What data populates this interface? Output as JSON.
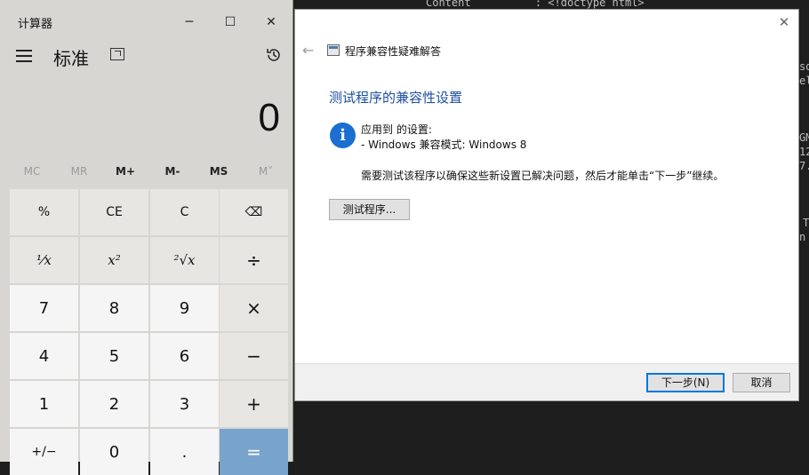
{
  "terminal": {
    "lines": [
      "Content          : <!doctype html>",
      "sd",
      "el",
      "GM",
      "12",
      "7.",
      "T",
      "n"
    ]
  },
  "calculator": {
    "title": "计算器",
    "window_buttons": {
      "minimize": "─",
      "maximize": "☐",
      "close": "✕"
    },
    "mode": "标准",
    "display": "0",
    "memory": [
      "MC",
      "MR",
      "M+",
      "M-",
      "MS",
      "M˅"
    ],
    "keys": [
      [
        "%",
        "CE",
        "C",
        "⌫"
      ],
      [
        "¹⁄x",
        "x²",
        "²√x",
        "÷"
      ],
      [
        "7",
        "8",
        "9",
        "×"
      ],
      [
        "4",
        "5",
        "6",
        "−"
      ],
      [
        "1",
        "2",
        "3",
        "+"
      ],
      [
        "+/−",
        "0",
        ".",
        "="
      ]
    ],
    "colors": {
      "background": "#d7d6d2",
      "equals": "#78a4cc"
    }
  },
  "dialog": {
    "close": "✕",
    "back": "←",
    "app_title": "程序兼容性疑难解答",
    "heading": "测试程序的兼容性设置",
    "applied_label": "应用到  的设置:",
    "applied_value": "- Windows 兼容模式: Windows 8",
    "instructions": "需要测试该程序以确保这些新设置已解决问题，然后才能单击“下一步”继续。",
    "test_button": "测试程序...",
    "next_button": "下一步(N)",
    "cancel_button": "取消",
    "colors": {
      "heading": "#1c4fa0",
      "info_icon": "#1a6fd0"
    }
  }
}
